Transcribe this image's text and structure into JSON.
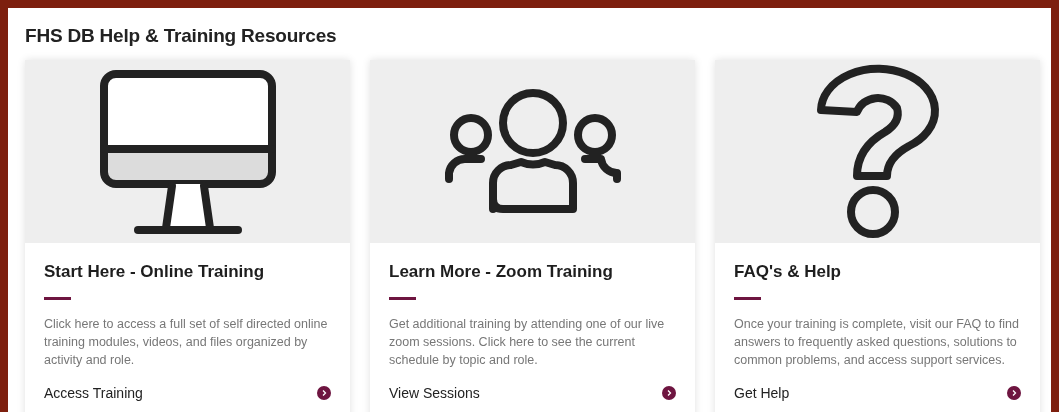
{
  "title": "FHS DB Help & Training Resources",
  "cards": [
    {
      "kind": "monitor",
      "heading": "Start Here - Online Training",
      "description": "Click here to access a full set of self directed online training modules, videos, and files organized by activity and role.",
      "link": "Access Training"
    },
    {
      "kind": "people",
      "heading": "Learn More - Zoom Training",
      "description": "Get additional training by attending one of our live zoom sessions.  Click here to see the current schedule by topic and role.",
      "link": "View Sessions"
    },
    {
      "kind": "question",
      "heading": "FAQ's & Help",
      "description": "Once your training is complete, visit our FAQ to find answers to frequently asked questions, solutions to common problems, and access support services.",
      "link": "Get Help"
    }
  ]
}
